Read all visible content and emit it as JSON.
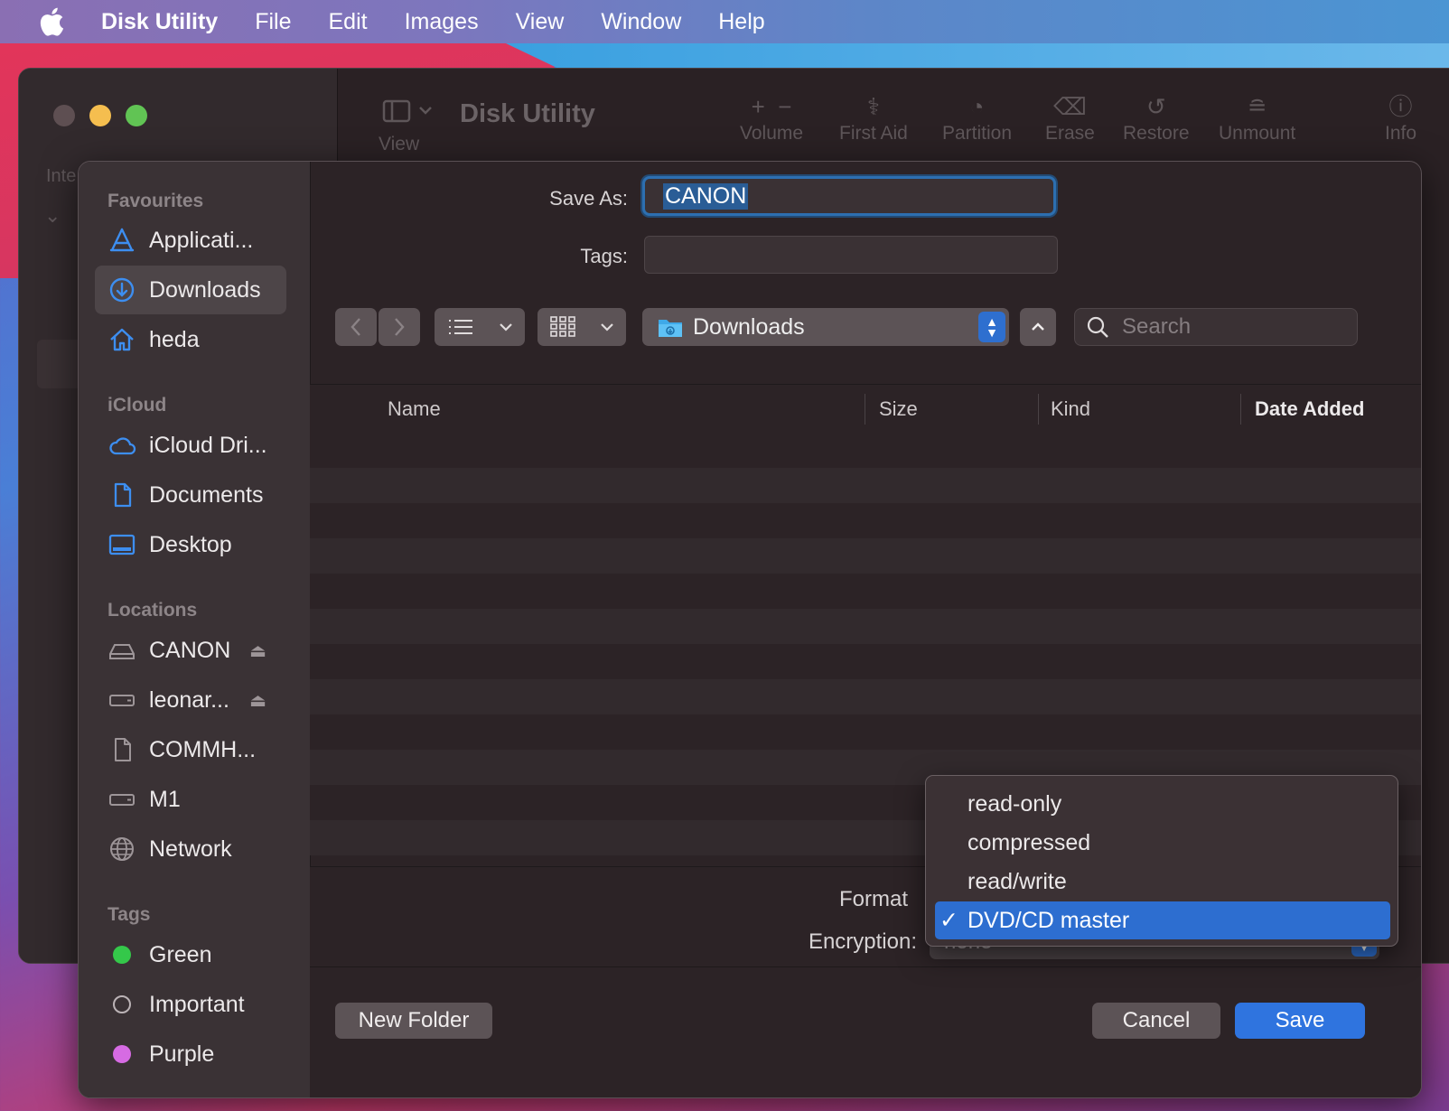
{
  "menubar": {
    "app": "Disk Utility",
    "items": [
      "File",
      "Edit",
      "Images",
      "View",
      "Window",
      "Help"
    ]
  },
  "background_window": {
    "title": "Disk Utility",
    "view_label": "View",
    "toolbar": [
      {
        "label": "Volume",
        "icon": "plus-minus-icon"
      },
      {
        "label": "First Aid",
        "icon": "stethoscope-icon"
      },
      {
        "label": "Partition",
        "icon": "pie-icon"
      },
      {
        "label": "Erase",
        "icon": "erase-icon"
      },
      {
        "label": "Restore",
        "icon": "restore-icon"
      },
      {
        "label": "Unmount",
        "icon": "unmount-icon"
      },
      {
        "label": "Info",
        "icon": "info-icon"
      }
    ],
    "sidebar_partial": "Inte"
  },
  "sidebar": {
    "favourites_header": "Favourites",
    "favourites": [
      {
        "label": "Applicati...",
        "icon": "applications-icon"
      },
      {
        "label": "Downloads",
        "icon": "downloads-icon",
        "selected": true
      },
      {
        "label": "heda",
        "icon": "home-icon"
      }
    ],
    "icloud_header": "iCloud",
    "icloud": [
      {
        "label": "iCloud Dri...",
        "icon": "cloud-icon"
      },
      {
        "label": "Documents",
        "icon": "document-icon"
      },
      {
        "label": "Desktop",
        "icon": "desktop-icon"
      }
    ],
    "locations_header": "Locations",
    "locations": [
      {
        "label": "CANON",
        "icon": "drive-icon",
        "eject": true
      },
      {
        "label": "leonar...",
        "icon": "drive-icon",
        "eject": true
      },
      {
        "label": "COMMH...",
        "icon": "document-icon"
      },
      {
        "label": "M1",
        "icon": "drive-icon"
      },
      {
        "label": "Network",
        "icon": "globe-icon"
      }
    ],
    "tags_header": "Tags",
    "tags": [
      {
        "label": "Green",
        "color": "#34c84a"
      },
      {
        "label": "Important",
        "color": ""
      },
      {
        "label": "Purple",
        "color": "#d66be3"
      }
    ]
  },
  "dialog": {
    "save_as_label": "Save As:",
    "save_as_value": "CANON",
    "tags_label": "Tags:",
    "location": "Downloads",
    "search_placeholder": "Search",
    "columns": [
      "Name",
      "Size",
      "Kind",
      "Date Added"
    ],
    "format_label": "Format",
    "encryption_label": "Encryption:",
    "encryption_value": "none",
    "new_folder": "New Folder",
    "cancel": "Cancel",
    "save": "Save"
  },
  "format_menu": {
    "options": [
      "read-only",
      "compressed",
      "read/write",
      "DVD/CD master"
    ],
    "selected": "DVD/CD master",
    "check": "✓"
  },
  "colors": {
    "accent": "#2f74df",
    "close": "#ed6a5e",
    "minimize": "#f5be4f",
    "zoom": "#61c454"
  }
}
